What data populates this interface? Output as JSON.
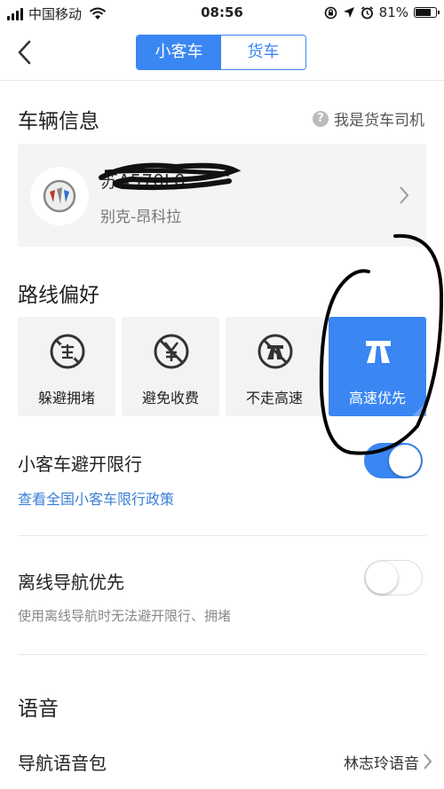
{
  "status": {
    "carrier": "中国移动",
    "time": "08:56",
    "battery": "81%",
    "battery_level": 0.81
  },
  "nav": {
    "tabs": [
      {
        "label": "小客车",
        "active": true
      },
      {
        "label": "货车",
        "active": false
      }
    ]
  },
  "vehicle": {
    "title": "车辆信息",
    "help_label": "我是货车司机",
    "plate": "苏A570L0",
    "model": "别克-昂科拉"
  },
  "route": {
    "title": "路线偏好",
    "options": [
      {
        "label": "躲避拥堵",
        "icon": "avoid-congestion-icon",
        "selected": false
      },
      {
        "label": "避免收费",
        "icon": "avoid-toll-icon",
        "selected": false
      },
      {
        "label": "不走高速",
        "icon": "no-highway-icon",
        "selected": false
      },
      {
        "label": "高速优先",
        "icon": "highway-icon",
        "selected": true
      }
    ]
  },
  "restriction": {
    "label": "小客车避开限行",
    "enabled": true,
    "link": "查看全国小客车限行政策"
  },
  "offline": {
    "label": "离线导航优先",
    "enabled": false,
    "note": "使用离线导航时无法避开限行、拥堵"
  },
  "voice": {
    "title": "语音",
    "pack_label": "导航语音包",
    "pack_value": "林志玲语音"
  },
  "colors": {
    "accent": "#3a86f3",
    "link": "#3a7fd6"
  }
}
